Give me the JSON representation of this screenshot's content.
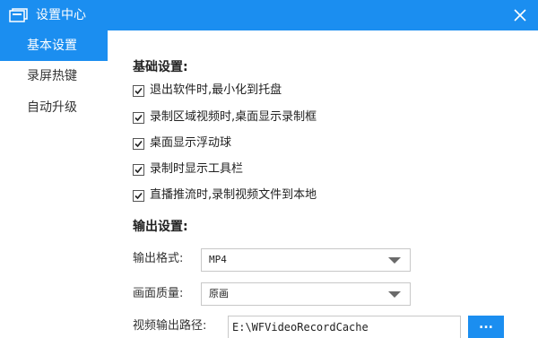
{
  "window": {
    "title": "设置中心",
    "accent": "#1b8ef0",
    "app_icon": "folder-stack-icon",
    "close_icon": "close-icon"
  },
  "sidebar": {
    "items": [
      {
        "label": "基本设置",
        "active": true
      },
      {
        "label": "录屏热键",
        "active": false
      },
      {
        "label": "自动升级",
        "active": false
      }
    ]
  },
  "basic": {
    "title": "基础设置:",
    "options": [
      {
        "label": "退出软件时,最小化到托盘",
        "checked": true
      },
      {
        "label": "录制区域视频时,桌面显示录制框",
        "checked": true
      },
      {
        "label": "桌面显示浮动球",
        "checked": true
      },
      {
        "label": "录制时显示工具栏",
        "checked": true
      },
      {
        "label": "直播推流时,录制视频文件到本地",
        "checked": true
      }
    ]
  },
  "output": {
    "title": "输出设置:",
    "format_label": "输出格式:",
    "format_value": "MP4",
    "quality_label": "画面质量:",
    "quality_value": "原画",
    "path_label": "视频输出路径:",
    "path_value": "E:\\WFVideoRecordCache",
    "browse_label": "..."
  }
}
